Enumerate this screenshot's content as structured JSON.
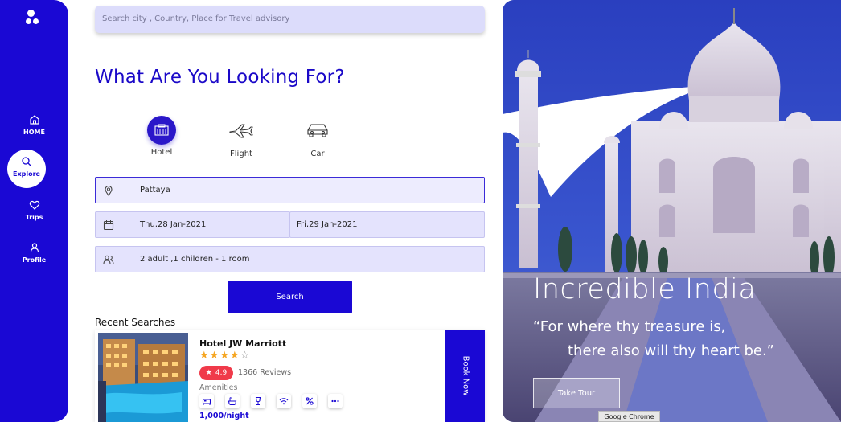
{
  "sidebar": {
    "items": [
      {
        "label": "HOME",
        "icon": "home-icon"
      },
      {
        "label": "Explore",
        "icon": "search-icon"
      },
      {
        "label": "Trips",
        "icon": "heart-icon"
      },
      {
        "label": "Profile",
        "icon": "user-icon"
      }
    ]
  },
  "search": {
    "placeholder": "Search city , Country, Place for Travel advisory"
  },
  "main": {
    "heading": "What Are You Looking For?",
    "categories": [
      {
        "label": "Hotel",
        "icon": "hotel-icon"
      },
      {
        "label": "Flight",
        "icon": "airplane-icon"
      },
      {
        "label": "Car",
        "icon": "car-icon"
      }
    ],
    "location": "Pattaya",
    "checkin": "Thu,28 Jan-2021",
    "checkout": "Fri,29 Jan-2021",
    "guests": "2 adult ,1 children - 1 room",
    "search_button": "Search",
    "recent_title": "Recent Searches"
  },
  "card": {
    "hotel_name": "Hotel JW Marriott",
    "stars": 4,
    "rating": "4.9",
    "reviews": "1366 Reviews",
    "amenities_label": "Amenities",
    "amenities": [
      "bed-icon",
      "bath-icon",
      "drink-icon",
      "wifi-icon",
      "percent-icon",
      "more-icon"
    ],
    "price": "1,000/night",
    "book_label": "Book Now"
  },
  "hero": {
    "title": "Incredible India",
    "quote_line1": "“For where thy treasure is,",
    "quote_line2": "there also will thy heart be.”",
    "tour_button": "Take Tour"
  },
  "tooltip": "Google Chrome",
  "colors": {
    "brand": "#1a08d4",
    "rating": "#f03a4a",
    "star": "#f5a623"
  }
}
